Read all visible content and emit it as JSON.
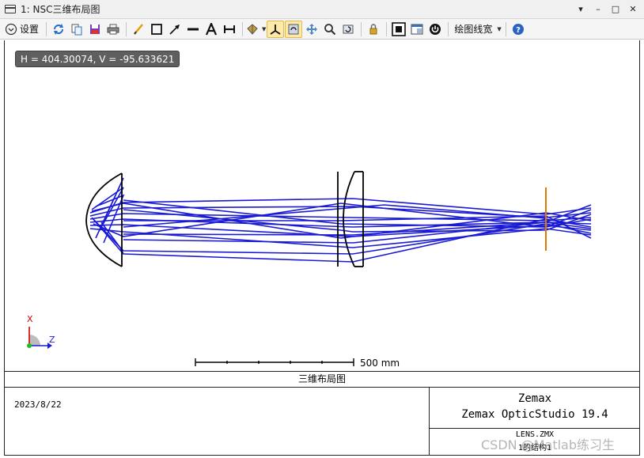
{
  "window": {
    "title": "1: NSC三维布局图",
    "controls": [
      "▾",
      "–",
      "□",
      "✕"
    ]
  },
  "toolbar": {
    "settings_label": "设置",
    "line_width_label": "绘图线宽"
  },
  "plot": {
    "coordinate_readout": "H = 404.30074, V = -95.633621",
    "scale_bar_label": "500 mm",
    "axis_x_label": "X",
    "axis_z_label": "Z",
    "ray_color": "#1a1ad6",
    "detector_color": "#e07800"
  },
  "footer": {
    "caption": "三维布局图",
    "date": "2023/8/22",
    "company": "Zemax",
    "product": "Zemax OpticStudio 19.4",
    "file_name": "LENS.ZMX",
    "config": "1的结构1"
  },
  "watermark": "CSDN @Matlab练习生"
}
